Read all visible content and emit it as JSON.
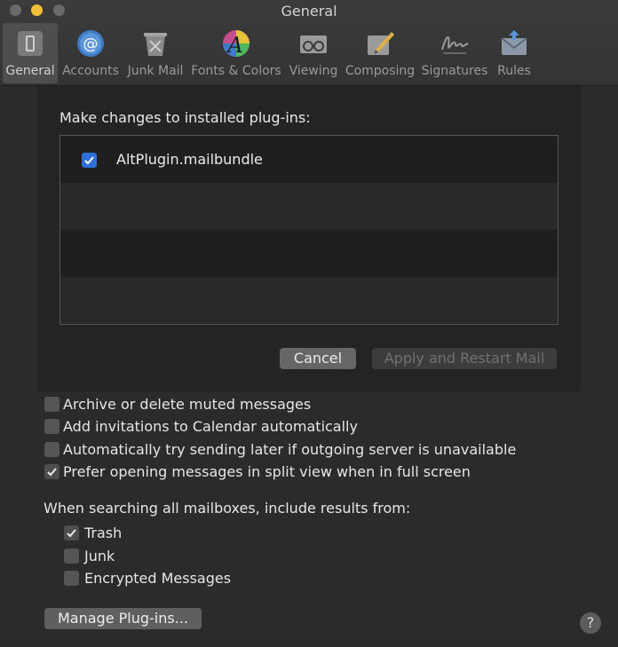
{
  "window": {
    "title": "General"
  },
  "toolbar": {
    "tabs": [
      {
        "label": "General",
        "icon": "general-icon"
      },
      {
        "label": "Accounts",
        "icon": "accounts-icon"
      },
      {
        "label": "Junk Mail",
        "icon": "junk-mail-icon"
      },
      {
        "label": "Fonts & Colors",
        "icon": "fonts-colors-icon"
      },
      {
        "label": "Viewing",
        "icon": "viewing-icon"
      },
      {
        "label": "Composing",
        "icon": "composing-icon"
      },
      {
        "label": "Signatures",
        "icon": "signatures-icon"
      },
      {
        "label": "Rules",
        "icon": "rules-icon"
      }
    ],
    "selected": "General"
  },
  "plugins_sheet": {
    "label": "Make changes to installed plug-ins:",
    "plugins": [
      {
        "name": "AltPlugin.mailbundle",
        "checked": true
      }
    ],
    "cancel_label": "Cancel",
    "apply_label": "Apply and Restart Mail",
    "apply_enabled": false
  },
  "options": [
    {
      "label": "Archive or delete muted messages",
      "checked": false
    },
    {
      "label": "Add invitations to Calendar automatically",
      "checked": false
    },
    {
      "label": "Automatically try sending later if outgoing server is unavailable",
      "checked": false
    },
    {
      "label": "Prefer opening messages in split view when in full screen",
      "checked": true
    }
  ],
  "search": {
    "label": "When searching all mailboxes, include results from:",
    "items": [
      {
        "label": "Trash",
        "checked": true
      },
      {
        "label": "Junk",
        "checked": false
      },
      {
        "label": "Encrypted Messages",
        "checked": false
      }
    ]
  },
  "manage_label": "Manage Plug-ins...",
  "help_label": "?",
  "colors": {
    "accent": "#2f6fd8",
    "background": "#2b2b2b",
    "toolbar": "#3b3b3b",
    "traffic_yellow": "#f2bf3a"
  }
}
